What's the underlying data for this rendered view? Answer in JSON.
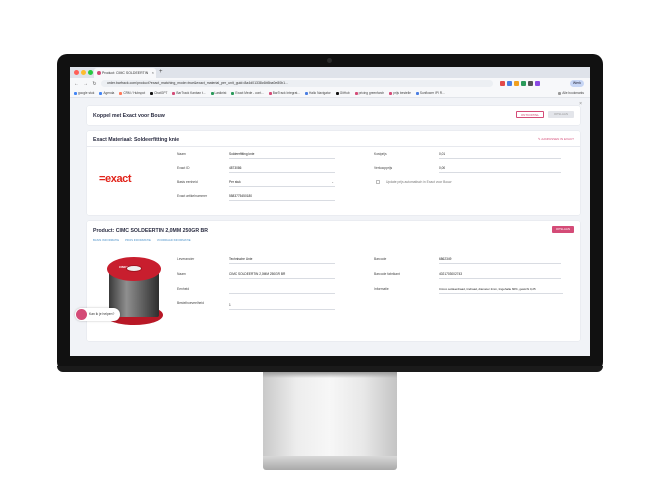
{
  "browser": {
    "tab_title": "Product: CIMC SOLDEERTIN",
    "tab_close": "×",
    "new_tab": "+",
    "url": "order.barfrack.com/product?exact_matching_mode=true&exact_material_per_unit_guid=8a4d01338c6b5ba0e80b1...",
    "profile": "Werk",
    "bookmarks": [
      "google stuk",
      "Agenda",
      "CRM / Hubspot",
      "ChatGPT",
      "BarTrack Kanban t...",
      "Lastkrist",
      "Exact Mede - cont...",
      "BarTrack Integrat...",
      "Hallo Navigator",
      "GitHub",
      "pricing greenfarch",
      "prijs bestelle",
      "Sunflower IPI R..."
    ],
    "bookmarks_right": "Alle bookmarks"
  },
  "page": {
    "close": "×",
    "koppel": {
      "title": "Koppel met Exact voor Bouw",
      "btn_cancel": "ONTKOPPEL",
      "btn_save": "OPSLAAN"
    },
    "exact": {
      "title": "Exact Materiaal: Soldeerfitting knie",
      "edit_link": "✎ AANPASSEN IN EXACT",
      "logo": "=exact",
      "fields_left": [
        {
          "label": "Naam",
          "value": "Soldeerfitting knie"
        },
        {
          "label": "Exact ID",
          "value": "4873086"
        },
        {
          "label": "Basis eenheid",
          "value": "Per stuk"
        },
        {
          "label": "Exact artikelnummer",
          "value": "5583775450180"
        }
      ],
      "fields_right": [
        {
          "label": "Kostprijs",
          "value": "0,01"
        },
        {
          "label": "Verkoopprijs",
          "value": "0,00"
        }
      ],
      "checkbox_label": "Update prijs automatisch in Exact voor Bouw"
    },
    "product": {
      "title": "Product: CIMC SOLDEERTIN 2,0MM 250GR BR",
      "btn_save": "OPSLAAN",
      "subtabs": [
        "BASIS INFORMATIE",
        "PRIJS INFORMATIE",
        "VOORRAAD INFORMATIE"
      ],
      "spool_label": "CIMCO",
      "fields_left": [
        {
          "label": "Leverancier",
          "value": "Technische Unie"
        },
        {
          "label": "Naam",
          "value": "CIMC SOLDEERTIN 2,0MM 250GR BR"
        },
        {
          "label": "Eenheid",
          "value": ""
        },
        {
          "label": "Bestelhoeveelheid",
          "value": "1"
        }
      ],
      "fields_right": [
        {
          "label": "Barcode",
          "value": "6862349"
        },
        {
          "label": "Barcode fabrikant",
          "value": "4021703002743"
        },
        {
          "label": "Informatie",
          "value": "Cimco soldeerdraad, tindraad, diameter 2mm, tingehalte 60%, gewicht 0,25"
        }
      ]
    },
    "chat": {
      "label": "Kan ik je helpen?"
    }
  },
  "colors": {
    "accent": "#d44b77",
    "exact_red": "#e2231a",
    "link_blue": "#4a90c8"
  }
}
